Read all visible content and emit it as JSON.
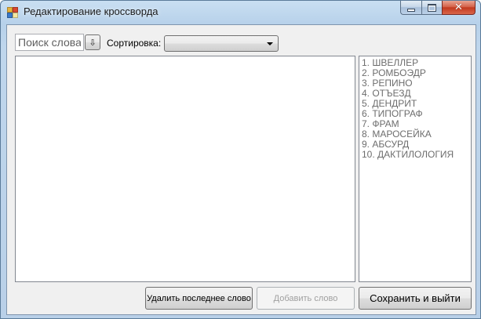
{
  "window": {
    "title": "Редактирование кроссворда",
    "icon": "crossword-app-icon",
    "app_icon_colors": [
      "#e8b23a",
      "#d9462f",
      "#3a78c9",
      "#f4e7a0"
    ],
    "controls": {
      "minimize_icon": "minimize-icon",
      "maximize_icon": "maximize-icon",
      "close_icon": "close-icon",
      "close_glyph": "✕"
    }
  },
  "toolbar": {
    "search_placeholder": "Поиск слова",
    "search_button_glyph": "⇩",
    "sort_label": "Сортировка:",
    "sort_selected": ""
  },
  "words": [
    "1. ШВЕЛЛЕР",
    "2. РОМБОЭДР",
    "3. РЕПИНО",
    "4. ОТЪЕЗД",
    "5. ДЕНДРИТ",
    "6. ТИПОГРАФ",
    "7. ФРАМ",
    "8. МАРОСЕЙКА",
    "9. АБСУРД",
    "10. ДАКТИЛОЛОГИЯ"
  ],
  "buttons": {
    "delete_last": "Удалить последнее слово",
    "add_word": "Добавить слово",
    "save_exit": "Сохранить и выйти"
  }
}
